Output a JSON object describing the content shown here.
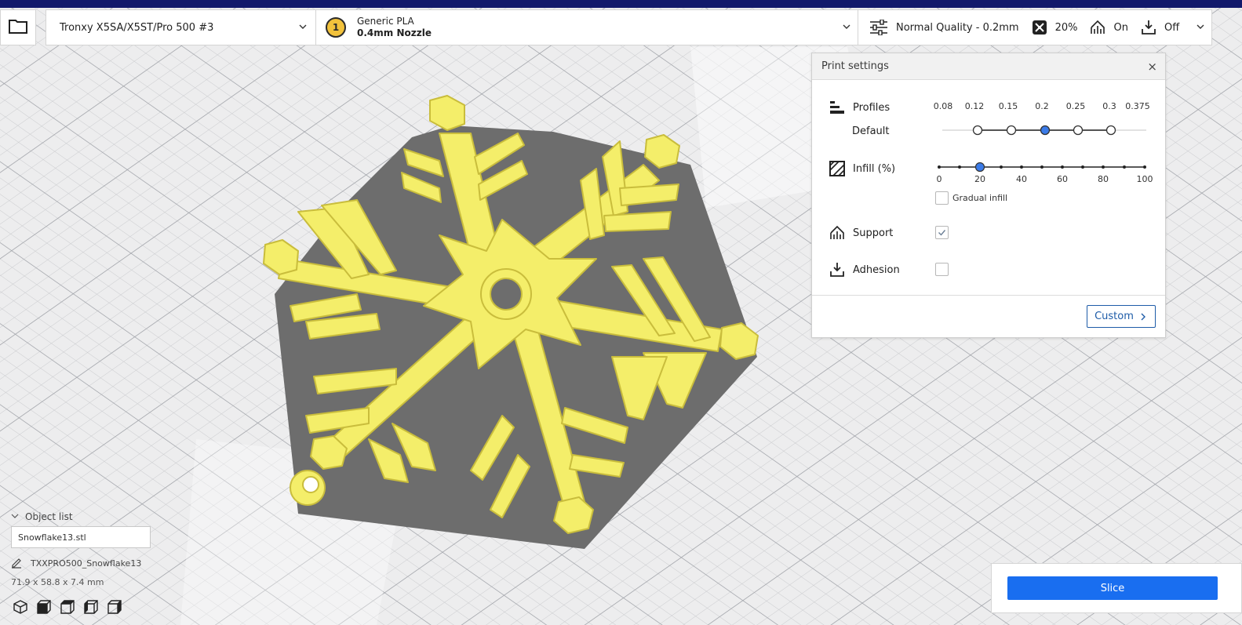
{
  "toolbar": {
    "printer": "Tronxy X5SA/X5ST/Pro 500 #3",
    "extruder_number": "1",
    "material_name": "Generic PLA",
    "nozzle": "0.4mm Nozzle",
    "quality": "Normal Quality - 0.2mm",
    "infill": "20%",
    "support": "On",
    "adhesion": "Off"
  },
  "print_settings": {
    "title": "Print settings",
    "close": "×",
    "profiles_label": "Profiles",
    "profiles_default": "Default",
    "layer_heights": [
      "0.08",
      "0.12",
      "0.15",
      "0.2",
      "0.25",
      "0.3",
      "0.375"
    ],
    "selected_layer_height": "0.2",
    "infill_label": "Infill (%)",
    "infill_ticks": [
      "0",
      "20",
      "40",
      "60",
      "80",
      "100"
    ],
    "infill_value": 20,
    "gradual_infill_label": "Gradual infill",
    "gradual_infill_checked": false,
    "support_label": "Support",
    "support_checked": true,
    "adhesion_label": "Adhesion",
    "adhesion_checked": false,
    "custom_button": "Custom"
  },
  "object_list": {
    "header": "Object list",
    "selected_file": "Snowflake13.stl",
    "job_name": "TXXPRO500_Snowflake13",
    "dimensions": "71.9 x 58.8 x 7.4 mm"
  },
  "slice": {
    "button": "Slice"
  },
  "colors": {
    "accent": "#196ef0",
    "top_stripe": "#12196b",
    "model": "#f4ee6a",
    "model_shadow": "#c9bd3c",
    "build_shadow": "#6d6d6d"
  },
  "icons": {
    "open": "folder-icon",
    "chevron": "chevron-down-icon",
    "quality": "sliders-icon",
    "infill": "infill-icon",
    "support": "support-icon",
    "adhesion": "adhesion-icon",
    "close": "close-icon",
    "edit": "pencil-icon",
    "views": [
      "view-3d-icon",
      "view-front-icon",
      "view-top-icon",
      "view-left-icon",
      "view-right-icon"
    ]
  }
}
